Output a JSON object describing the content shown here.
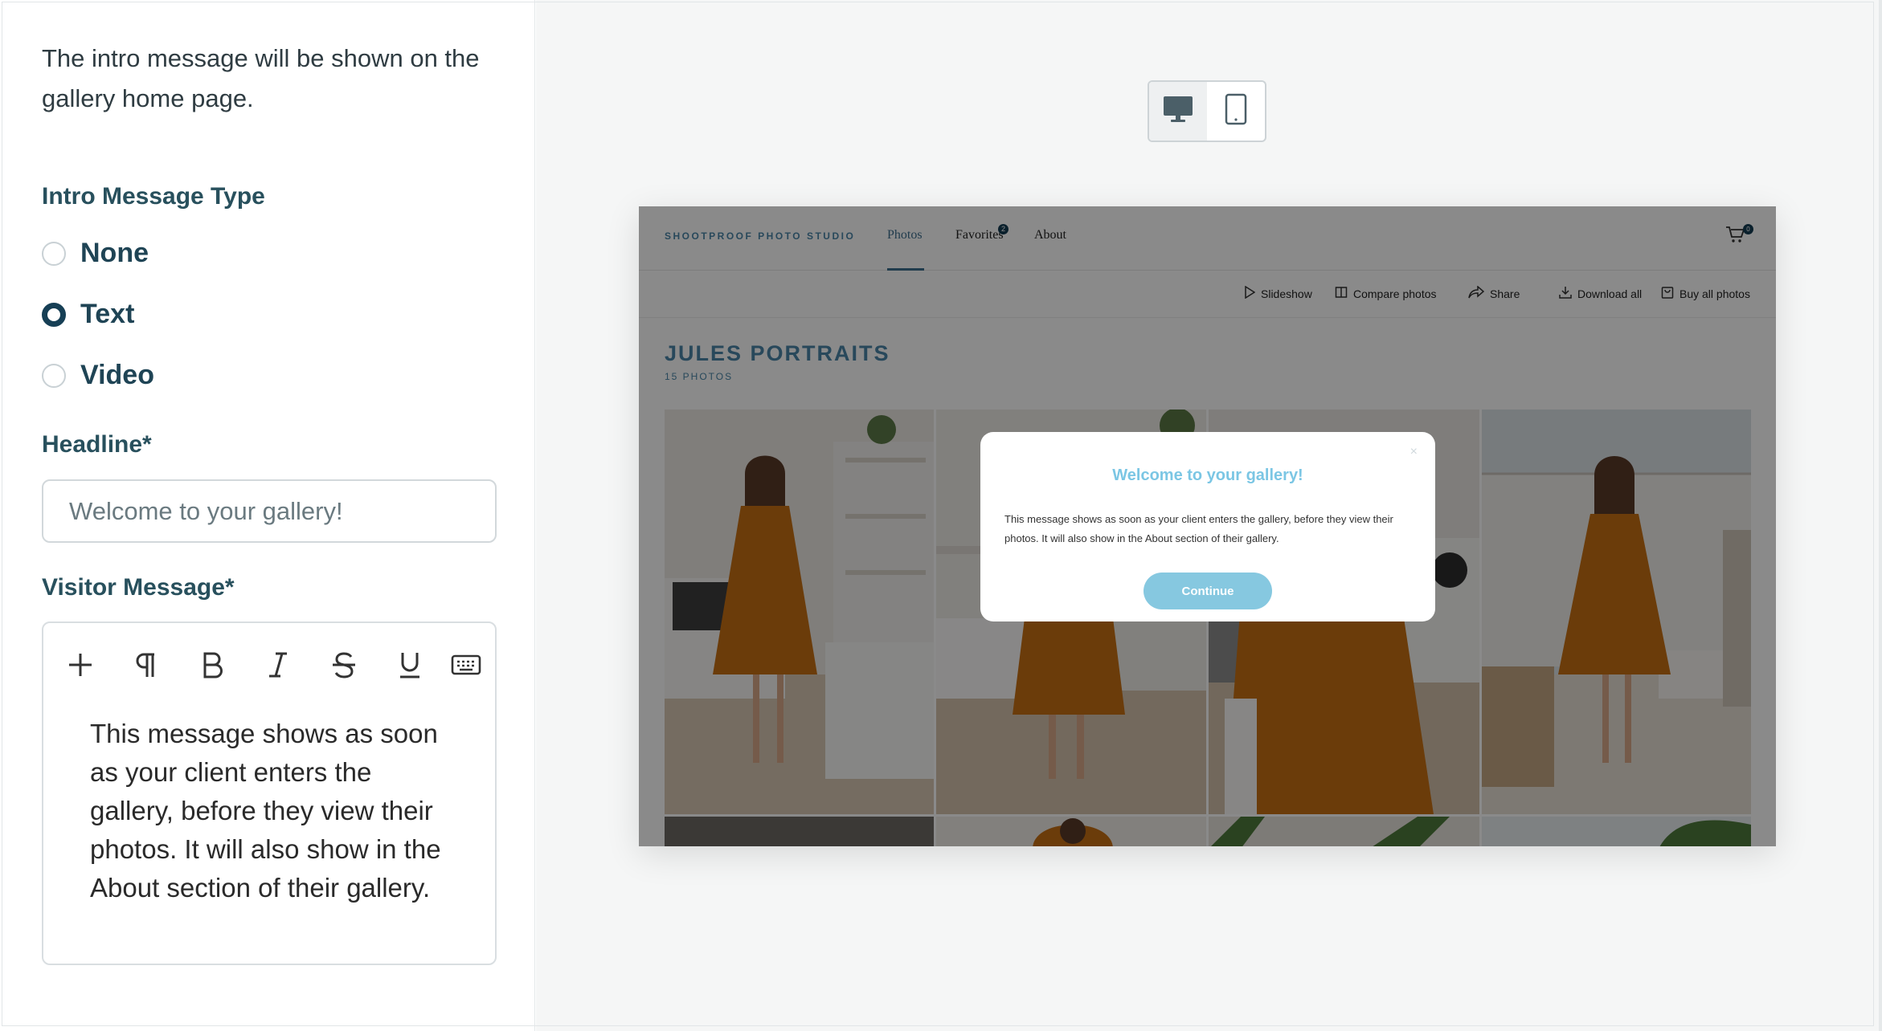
{
  "settings": {
    "intro_text": "The intro message will be shown on the gallery home page.",
    "type_label": "Intro Message Type",
    "type_options": [
      {
        "label": "None",
        "selected": false
      },
      {
        "label": "Text",
        "selected": true
      },
      {
        "label": "Video",
        "selected": false
      }
    ],
    "headline_label": "Headline*",
    "headline_value": "Welcome to your gallery!",
    "visitor_label": "Visitor Message*",
    "toolbar_icons": [
      "plus-icon",
      "paragraph-icon",
      "bold-icon",
      "italic-icon",
      "strikethrough-icon",
      "underline-icon",
      "keyboard-icon"
    ],
    "visitor_message": "This message shows as soon as your client enters the gallery, before they view their photos. It will also show in the About section of their gallery."
  },
  "device_toggle": {
    "options": [
      "desktop-icon",
      "tablet-icon"
    ],
    "active": "desktop"
  },
  "preview": {
    "studio_name": "SHOOTPROOF PHOTO STUDIO",
    "nav": [
      "Photos",
      "Favorites",
      "About"
    ],
    "active_nav": "Photos",
    "favorites_count": "2",
    "cart_count": "0",
    "actions": [
      "Slideshow",
      "Compare photos",
      "Share",
      "Download all",
      "Buy all photos"
    ],
    "gallery_title": "JULES PORTRAITS",
    "photo_count": "15 PHOTOS",
    "modal": {
      "close": "×",
      "title": "Welcome to your gallery!",
      "body": "This message shows as soon as your client enters the gallery, before they view their photos. It will also show in the About section of their gallery.",
      "button": "Continue"
    },
    "colors": {
      "accent": "#4a86a8",
      "dress": "#c66f14",
      "modal_title": "#7bc6e4",
      "button": "#86c8e0"
    }
  }
}
